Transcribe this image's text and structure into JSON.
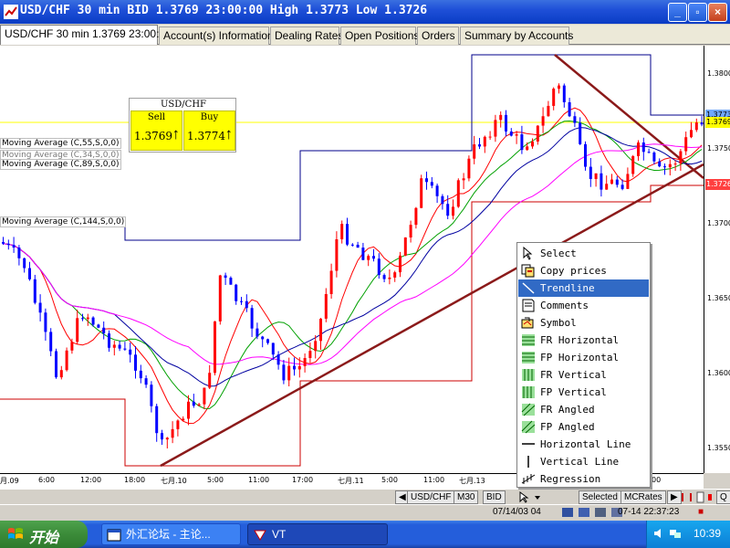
{
  "window": {
    "title": "USD/CHF 30 min BID 1.3769 23:00:00 High 1.3773 Low 1.3726",
    "min_label": "_",
    "max_label": "▫",
    "close_label": "×"
  },
  "tabs": [
    {
      "label": "USD/CHF 30 min 1.3769 23:00:00"
    },
    {
      "label": "Account(s) Information"
    },
    {
      "label": "Dealing Rates"
    },
    {
      "label": "Open Positions"
    },
    {
      "label": "Orders"
    },
    {
      "label": "Summary by Accounts"
    }
  ],
  "quote": {
    "pair": "USD/CHF",
    "sell_label": "Sell",
    "sell_value": "1.3769",
    "buy_label": "Buy",
    "buy_value": "1.3774",
    "arrow": "↑"
  },
  "indicators": [
    {
      "label": "Moving Average (C,55,S,0,0)"
    },
    {
      "label": "Moving Average (C,34,S,0,0)"
    },
    {
      "label": "Moving Average (C,89,S,0,0)"
    },
    {
      "label": "Moving Average (C,144,S,0,0)"
    }
  ],
  "price_axis": {
    "ticks": [
      "1.3800",
      "1.3750",
      "1.3700",
      "1.3650",
      "1.3600",
      "1.3550"
    ],
    "boxes": [
      {
        "label": "1.3773",
        "color": "#6fa8ff"
      },
      {
        "label": "1.3769",
        "color": "#ffff00"
      },
      {
        "label": "1.3726",
        "color": "#ff4040"
      }
    ]
  },
  "time_axis": {
    "ticks": [
      "月.09",
      "6:00",
      "12:00",
      "18:00",
      "七月.10",
      "5:00",
      "11:00",
      "17:00",
      "七月.11",
      "5:00",
      "11:00",
      "七月.13",
      "00"
    ]
  },
  "chart_bar": {
    "buttons": [
      "◀",
      "▶",
      "USD/CHF",
      "M30",
      "BID",
      "Selected",
      "MCRates",
      "Q"
    ]
  },
  "status_bar": {
    "left_time": "07/14/03 04",
    "right_time": "07-14 22:37:23"
  },
  "context_menu": {
    "items": [
      {
        "label": "Select",
        "icon": "cursor-icon"
      },
      {
        "label": "Copy prices",
        "icon": "copy-icon"
      },
      {
        "label": "Trendline",
        "icon": "trendline-icon",
        "highlighted": true
      },
      {
        "label": "Comments",
        "icon": "comment-icon"
      },
      {
        "label": "Symbol",
        "icon": "symbol-icon"
      },
      {
        "label": "FR Horizontal",
        "icon": "fr-horizontal-icon"
      },
      {
        "label": "FP Horizontal",
        "icon": "fp-horizontal-icon"
      },
      {
        "label": "FR Vertical",
        "icon": "fr-vertical-icon"
      },
      {
        "label": "FP Vertical",
        "icon": "fp-vertical-icon"
      },
      {
        "label": "FR Angled",
        "icon": "fr-angled-icon"
      },
      {
        "label": "FP Angled",
        "icon": "fp-angled-icon"
      },
      {
        "label": "Horizontal Line",
        "icon": "horizontal-line-icon"
      },
      {
        "label": "Vertical Line",
        "icon": "vertical-line-icon"
      },
      {
        "label": "Regression",
        "icon": "regression-icon"
      }
    ]
  },
  "taskbar": {
    "start_label": "开始",
    "buttons": [
      {
        "label": "外汇论坛 - 主论..."
      },
      {
        "label": "VT"
      }
    ],
    "clock": "10:39"
  },
  "colors": {
    "bull_candle": "#ff0000",
    "bear_candle": "#0000ff",
    "ma34": "#ff0000",
    "ma55": "#00a000",
    "ma89": "#0000a0",
    "ma144": "#ff00ff",
    "trendline": "#8b1a1a",
    "channel_high": "#00008b",
    "channel_low": "#cc0000",
    "bid_line": "#ffff00"
  }
}
